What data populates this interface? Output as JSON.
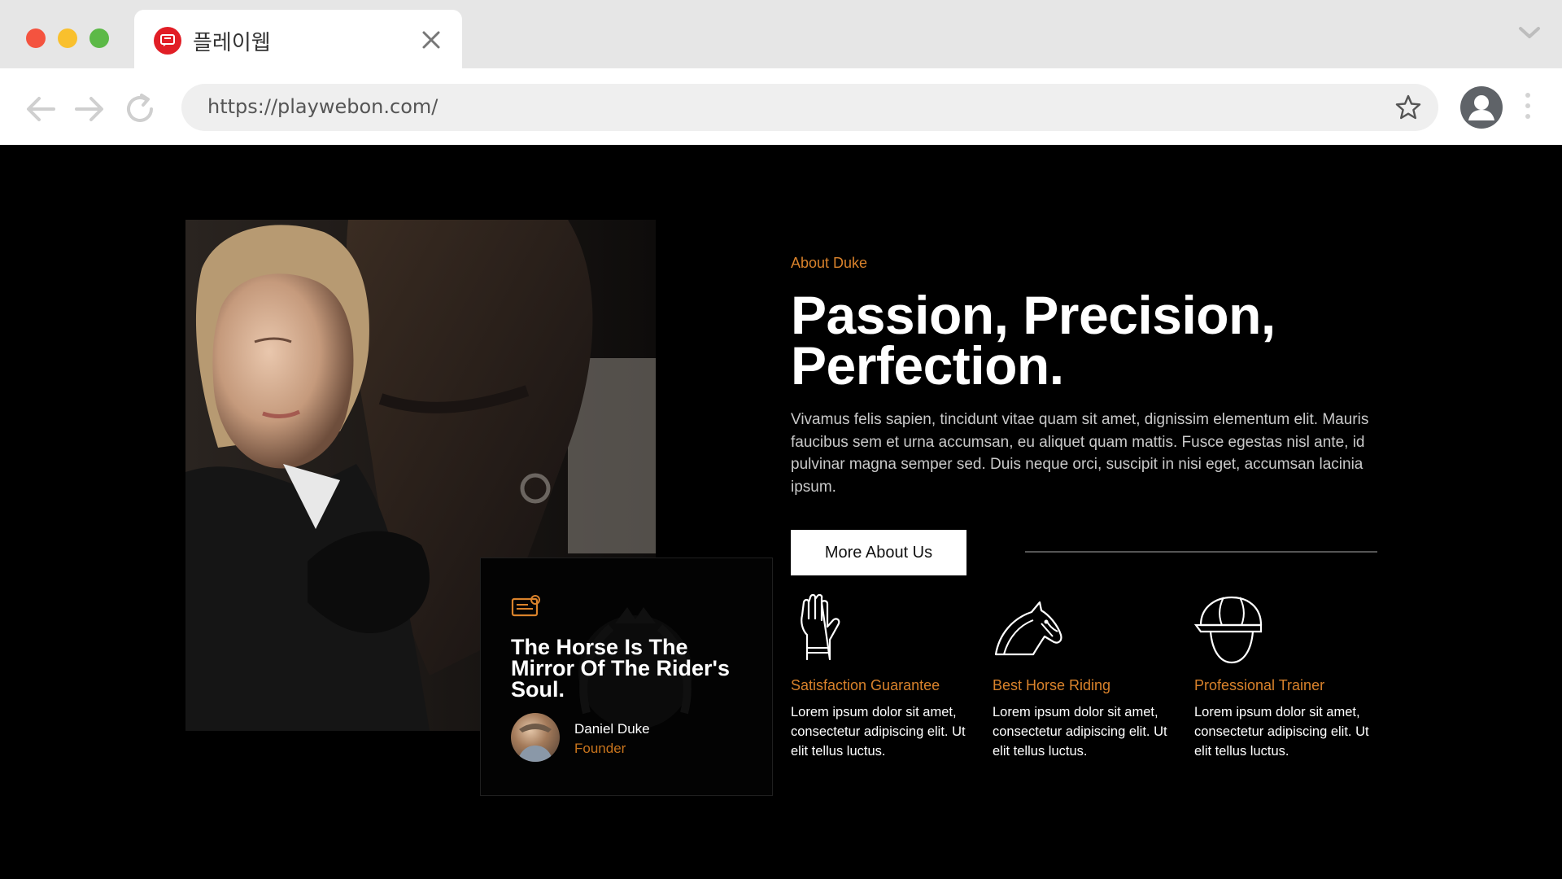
{
  "browser": {
    "tab_title": "플레이웹",
    "url": "https://playwebon.com/"
  },
  "about": {
    "eyebrow": "About Duke",
    "headline": "Passion, Precision, Perfection.",
    "body": "Vivamus felis sapien, tincidunt vitae quam sit amet, dignissim elementum elit. Mauris faucibus sem et urna accumsan, eu aliquet quam mattis. Fusce egestas nisl ante, id pulvinar magna semper sed. Duis neque orci, suscipit in nisi eget, accumsan lacinia ipsum.",
    "cta_label": "More About Us"
  },
  "quote": {
    "text": "The Horse Is The Mirror Of The Rider's Soul.",
    "author_name": "Daniel Duke",
    "author_role": "Founder"
  },
  "features": [
    {
      "icon": "glove-icon",
      "title": "Satisfaction Guarantee",
      "text": "Lorem ipsum dolor sit amet, consectetur adipiscing elit. Ut elit tellus luctus."
    },
    {
      "icon": "horse-head-icon",
      "title": "Best Horse Riding",
      "text": "Lorem ipsum dolor sit amet, consectetur adipiscing elit. Ut elit tellus luctus."
    },
    {
      "icon": "riding-helmet-icon",
      "title": "Professional Trainer",
      "text": "Lorem ipsum dolor sit amet, consectetur adipiscing elit. Ut elit tellus luctus."
    }
  ],
  "colors": {
    "accent": "#d9822b",
    "background": "#000000",
    "cta_background": "#ffffff"
  }
}
